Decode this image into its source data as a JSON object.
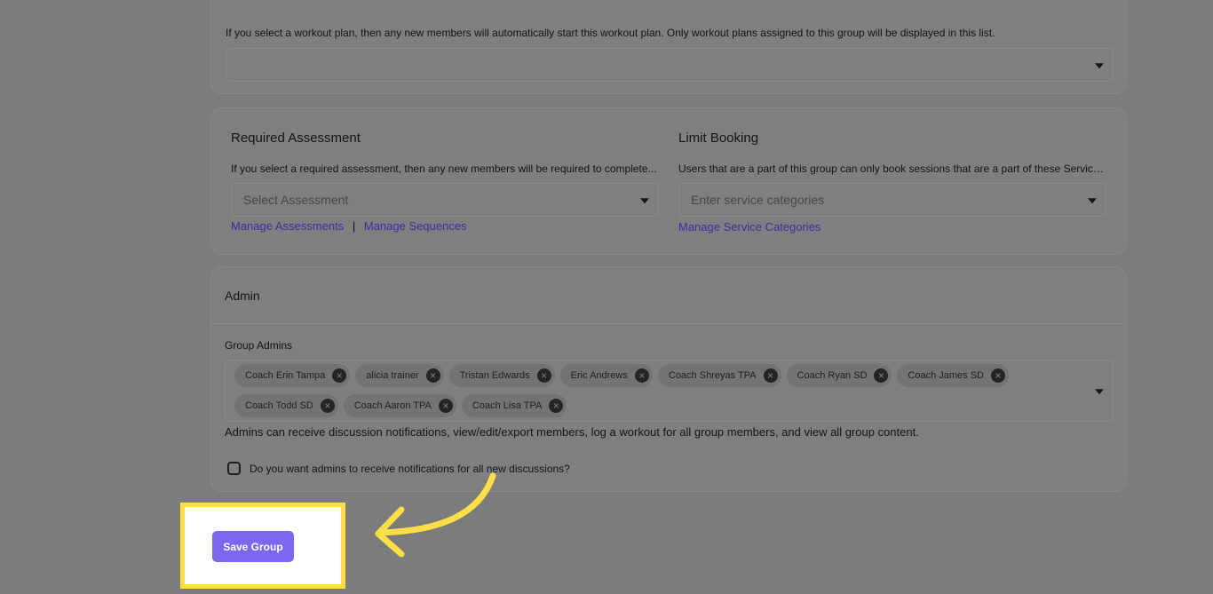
{
  "workout_section": {
    "help_text": "If you select a workout plan, then any new members will automatically start this workout plan. Only workout plans assigned to this group will be displayed in this list."
  },
  "assessment": {
    "title": "Required Assessment",
    "help_text": "If you select a required assessment, then any new members will be required to complete...",
    "placeholder": "Select Assessment",
    "manage_assessments_label": "Manage Assessments",
    "separator": "|",
    "manage_sequences_label": "Manage Sequences"
  },
  "limit_booking": {
    "title": "Limit Booking",
    "help_text": "Users that are a part of this group can only book sessions that are a part of these Service...",
    "placeholder": "Enter service categories",
    "manage_link_label": "Manage Service Categories"
  },
  "admin": {
    "title": "Admin",
    "group_admins_label": "Group Admins",
    "admins_row1": [
      "Coach Erin Tampa",
      "alicia trainer",
      "Tristan Edwards",
      "Eric Andrews",
      "Coach Shreyas TPA",
      "Coach Ryan SD",
      "Coach James SD"
    ],
    "admins_row2": [
      "Coach Todd SD",
      "Coach Aaron TPA",
      "Coach Lisa TPA"
    ],
    "description": "Admins can receive discussion notifications, view/edit/export members, log a workout for all group members, and view all group content.",
    "notify_checkbox_label": "Do you want admins to receive notifications for all new discussions?"
  },
  "save_button_label": "Save Group",
  "colors": {
    "accent": "#7b68ee",
    "highlight": "#fde047",
    "overlay": "#7c7c7c"
  },
  "icons": {
    "remove_chip": "close-circle-icon",
    "dropdown": "caret-down-icon",
    "annotation": "curved-arrow-icon"
  }
}
